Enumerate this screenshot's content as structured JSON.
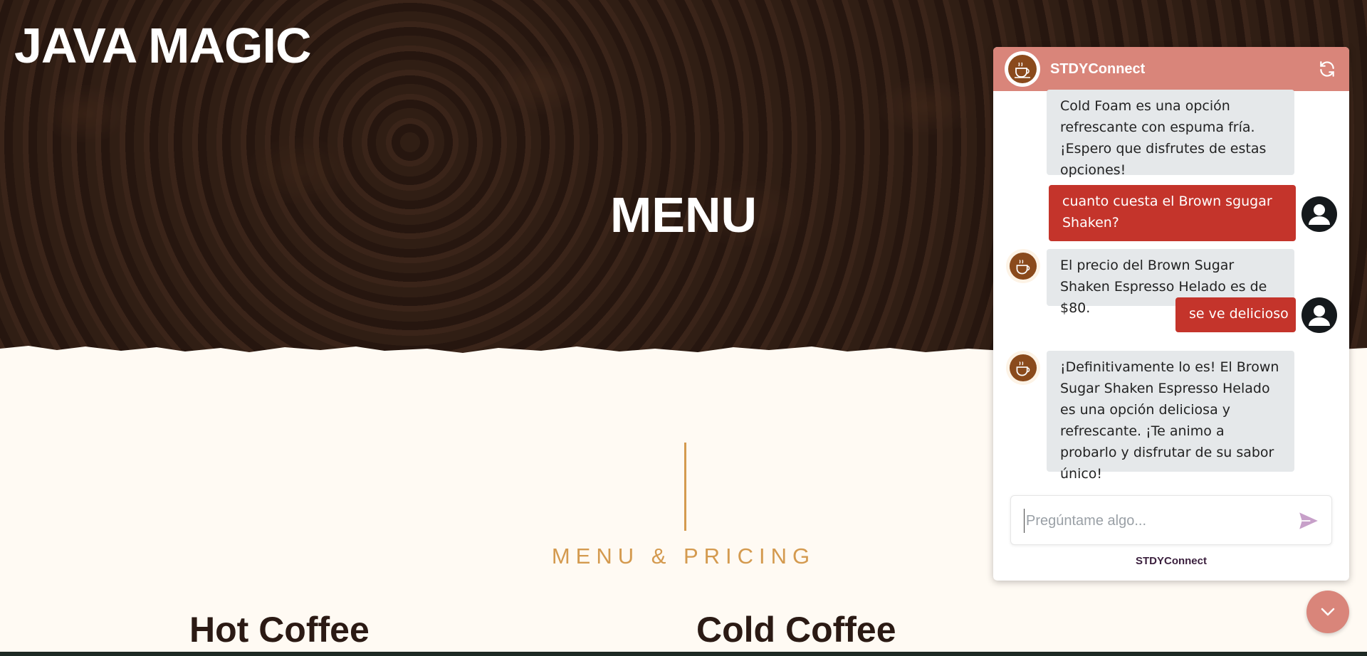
{
  "hero": {
    "brand": "JAVA MAGIC",
    "title": "MENU"
  },
  "section": {
    "label": "MENU & PRICING",
    "categories": [
      "Hot Coffee",
      "Cold Coffee"
    ]
  },
  "chat": {
    "title": "STDYConnect",
    "messages": [
      {
        "from": "bot",
        "text": "Cold Foam es una opción refrescante con espuma fría. ¡Espero que disfrutes de estas opciones!"
      },
      {
        "from": "user",
        "text": "cuanto cuesta el Brown sgugar Shaken?"
      },
      {
        "from": "bot",
        "text": "El precio del Brown Sugar Shaken Espresso Helado es de $80."
      },
      {
        "from": "user",
        "text": "se ve delicioso"
      },
      {
        "from": "bot",
        "text": "¡Definitivamente lo es! El Brown Sugar Shaken Espresso Helado es una opción deliciosa y refrescante. ¡Te animo a probarlo y disfrutar de su sabor único!"
      }
    ],
    "input_placeholder": "Pregúntame algo...",
    "footer": "STDYConnect"
  },
  "colors": {
    "header": "#d9857a",
    "user_bubble": "#c4342b",
    "bot_bubble": "#e5e8ea",
    "accent": "#d49a4f"
  },
  "icons": {
    "logo": "coffee-cup-icon",
    "refresh": "refresh-icon",
    "send": "send-icon",
    "user_avatar": "user-icon",
    "collapse": "chevron-down-icon"
  }
}
